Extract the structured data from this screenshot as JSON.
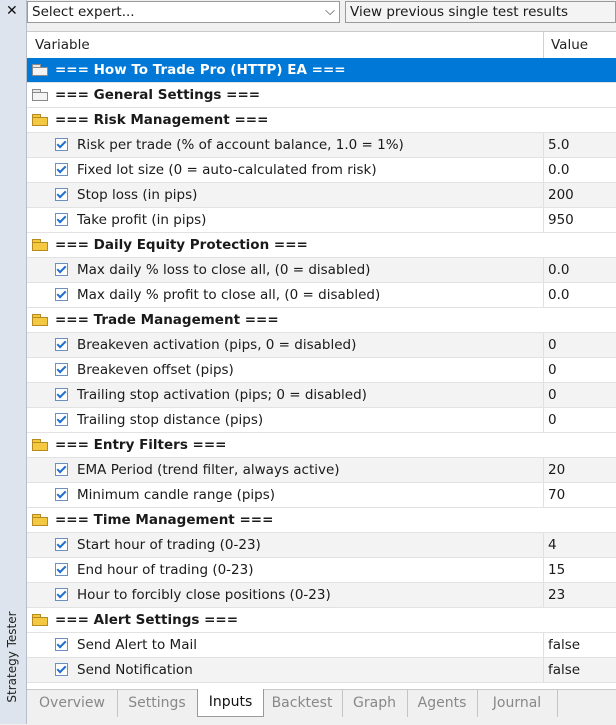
{
  "side": {
    "close_glyph": "✕",
    "panel_title": "Strategy Tester"
  },
  "toolbar": {
    "expert_select": "Select expert...",
    "view_previous": "View previous single test results"
  },
  "grid": {
    "col_variable": "Variable",
    "col_value": "Value",
    "rows": [
      {
        "kind": "sel",
        "icon": "folder-grey-icon",
        "label": "=== How To Trade Pro (HTTP) EA ==="
      },
      {
        "kind": "cat",
        "icon": "folder-grey-icon",
        "label": "=== General Settings ==="
      },
      {
        "kind": "cat",
        "icon": "folder-icon",
        "label": "=== Risk Management ==="
      },
      {
        "kind": "item",
        "label": "Risk per trade (%  of account balance, 1.0 = 1%)",
        "value": "5.0"
      },
      {
        "kind": "item",
        "label": "Fixed lot size (0 = auto-calculated from risk)",
        "value": "0.0"
      },
      {
        "kind": "item",
        "label": "Stop loss (in pips)",
        "value": "200"
      },
      {
        "kind": "item",
        "label": "Take profit (in pips)",
        "value": "950"
      },
      {
        "kind": "cat",
        "icon": "folder-icon",
        "label": "=== Daily Equity Protection ==="
      },
      {
        "kind": "item",
        "label": "Max daily % loss to close all, (0 = disabled)",
        "value": "0.0"
      },
      {
        "kind": "item",
        "label": "Max daily % profit to close all, (0 = disabled)",
        "value": "0.0"
      },
      {
        "kind": "cat",
        "icon": "folder-icon",
        "label": "=== Trade Management ==="
      },
      {
        "kind": "item",
        "label": "Breakeven activation (pips, 0 = disabled)",
        "value": "0"
      },
      {
        "kind": "item",
        "label": "Breakeven offset (pips)",
        "value": "0"
      },
      {
        "kind": "item",
        "label": "Trailing stop activation (pips; 0 = disabled)",
        "value": "0"
      },
      {
        "kind": "item",
        "label": "Trailing stop distance (pips)",
        "value": "0"
      },
      {
        "kind": "cat",
        "icon": "folder-icon",
        "label": "=== Entry Filters ==="
      },
      {
        "kind": "item",
        "label": "EMA Period (trend filter, always active)",
        "value": "20"
      },
      {
        "kind": "item",
        "label": "Minimum candle range (pips)",
        "value": "70"
      },
      {
        "kind": "cat",
        "icon": "folder-icon",
        "label": "=== Time Management ==="
      },
      {
        "kind": "item",
        "label": "Start hour of trading (0-23)",
        "value": "4"
      },
      {
        "kind": "item",
        "label": "End hour of trading (0-23)",
        "value": "15"
      },
      {
        "kind": "item",
        "label": "Hour to forcibly close positions (0-23)",
        "value": "23"
      },
      {
        "kind": "cat",
        "icon": "folder-icon",
        "label": "=== Alert Settings ==="
      },
      {
        "kind": "item",
        "label": "Send Alert to Mail",
        "value": "false"
      },
      {
        "kind": "item",
        "label": "Send Notification",
        "value": "false"
      }
    ]
  },
  "tabs": {
    "active": "Inputs",
    "items": [
      "Overview",
      "Settings",
      "Inputs",
      "Backtest",
      "Graph",
      "Agents",
      "Journal"
    ]
  },
  "colors": {
    "selection": "#0078d7",
    "folder": "#f5c842",
    "checkbox": "#1f6fcf"
  }
}
